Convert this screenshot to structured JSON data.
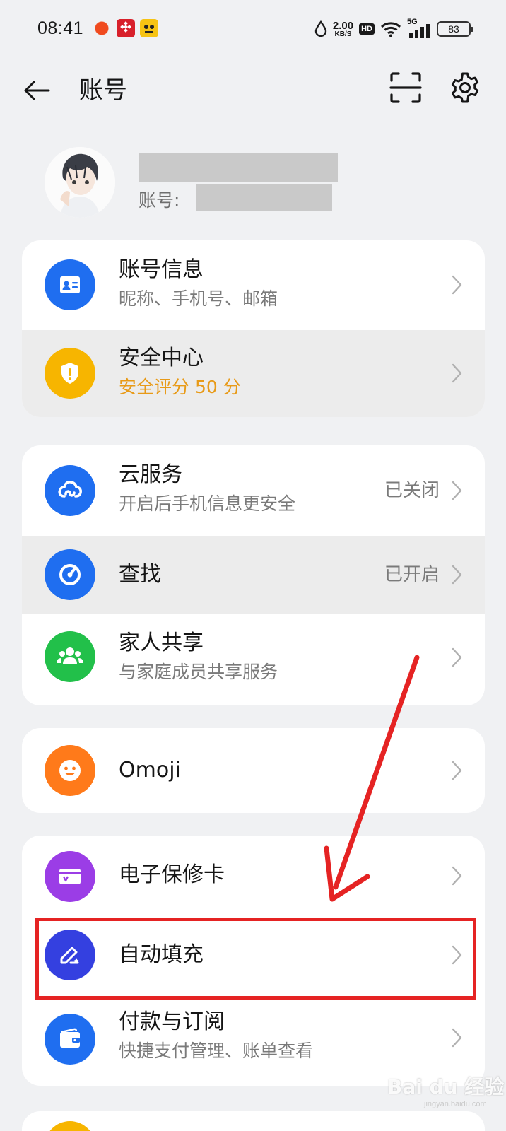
{
  "status_bar": {
    "time": "08:41",
    "net_speed_value": "2.00",
    "net_speed_unit": "KB/S",
    "hd_label": "HD",
    "signal_label": "5G",
    "battery_level": "83"
  },
  "header": {
    "title": "账号"
  },
  "profile": {
    "account_label": "账号:"
  },
  "account_card": [
    {
      "title": "账号信息",
      "subtitle": "昵称、手机号、邮箱",
      "icon": "id-card-icon",
      "icon_color": "#1f6ef0"
    },
    {
      "title": "安全中心",
      "subtitle": "安全评分 50 分",
      "icon": "shield-icon",
      "icon_color": "#f7b500"
    }
  ],
  "service_card": [
    {
      "title": "云服务",
      "subtitle": "开启后手机信息更安全",
      "status": "已关闭",
      "icon": "cloud-icon",
      "icon_color": "#1f6ef0"
    },
    {
      "title": "查找",
      "status": "已开启",
      "icon": "find-device-icon",
      "icon_color": "#1f6ef0"
    },
    {
      "title": "家人共享",
      "subtitle": "与家庭成员共享服务",
      "icon": "family-icon",
      "icon_color": "#22c04a"
    }
  ],
  "omoji_card": [
    {
      "title": "Omoji",
      "icon": "smiley-icon",
      "icon_color": "#ff7a1a"
    }
  ],
  "tools_card": [
    {
      "title": "电子保修卡",
      "icon": "warranty-card-icon",
      "icon_color": "#9b3de6"
    },
    {
      "title": "自动填充",
      "icon": "autofill-pen-icon",
      "icon_color": "#3440e0"
    },
    {
      "title": "付款与订阅",
      "subtitle": "快捷支付管理、账单查看",
      "icon": "wallet-icon",
      "icon_color": "#1f6ef0"
    }
  ],
  "annotation": {
    "highlight_color": "#e52323"
  },
  "watermark": {
    "text": "Bai du 经验",
    "url": "jingyan.baidu.com"
  }
}
